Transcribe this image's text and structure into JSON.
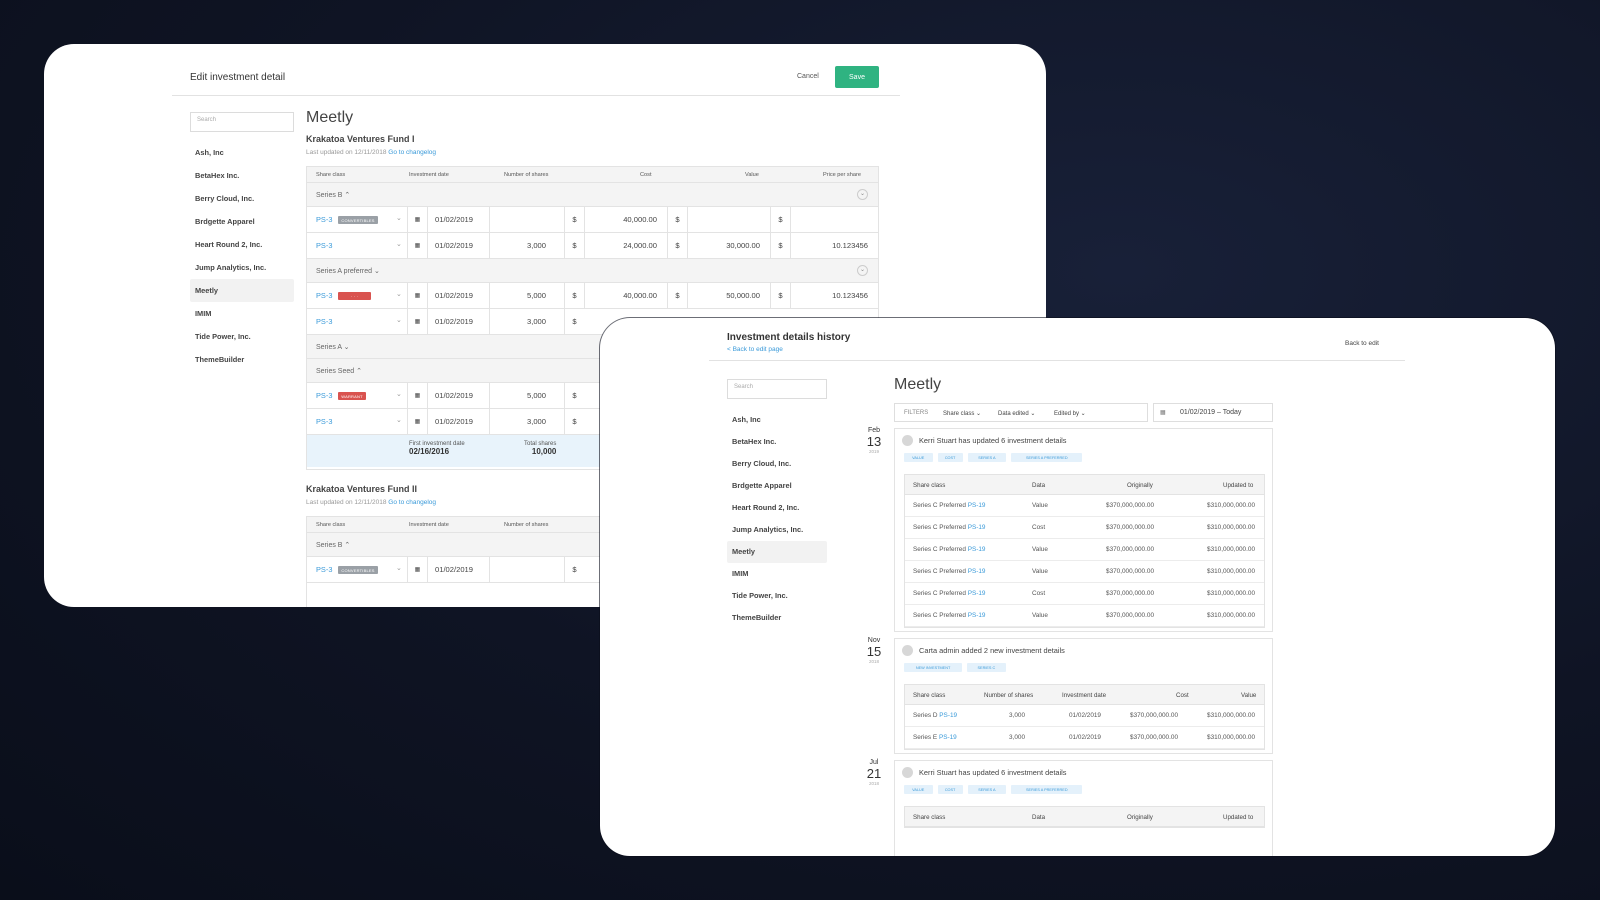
{
  "edit": {
    "title": "Edit investment detail",
    "cancel": "Cancel",
    "save": "Save",
    "search_placeholder": "Search",
    "companies": [
      "Ash, Inc",
      "BetaHex Inc.",
      "Berry Cloud, Inc.",
      "Brdgette Apparel",
      "Heart Round 2, Inc.",
      "Jump Analytics, Inc.",
      "Meetly",
      "IMIM",
      "Tide Power, Inc.",
      "ThemeBuilder"
    ],
    "active_company": "Meetly",
    "company_title": "Meetly",
    "fund1": {
      "name": "Krakatoa Ventures Fund I",
      "updated": "Last updated on 12/11/2018",
      "changelog": "Go to changelog",
      "headers": [
        "Share class",
        "Investment date",
        "Number of shares",
        "Cost",
        "Value",
        "Price per share"
      ],
      "groups": {
        "b": "Series B ⌃",
        "ap": "Series A preferred ⌄",
        "a": "Series A ⌄",
        "seed": "Series Seed ⌃"
      },
      "rows": [
        {
          "ps": "PS-3",
          "tag": "CONVERTIBLES",
          "date": "01/02/2019",
          "shares": "",
          "cost": "40,000.00",
          "value": "",
          "pps": ""
        },
        {
          "ps": "PS-3",
          "tag": "",
          "date": "01/02/2019",
          "shares": "3,000",
          "cost": "24,000.00",
          "value": "30,000.00",
          "pps": "10.123456"
        },
        {
          "ps": "PS-3",
          "tag": "· · ·",
          "date": "01/02/2019",
          "shares": "5,000",
          "cost": "40,000.00",
          "value": "50,000.00",
          "pps": "10.123456"
        },
        {
          "ps": "PS-3",
          "tag": "",
          "date": "01/02/2019",
          "shares": "3,000"
        },
        {
          "ps": "PS-3",
          "tag": "WARRANT",
          "date": "01/02/2019",
          "shares": "5,000"
        },
        {
          "ps": "PS-3",
          "tag": "",
          "date": "01/02/2019",
          "shares": "3,000"
        }
      ],
      "currency": "$",
      "summary": {
        "first_label": "First investment date",
        "first_value": "02/16/2016",
        "total_label": "Total shares",
        "total_value": "10,000"
      }
    },
    "fund2": {
      "name": "Krakatoa Ventures Fund II",
      "updated": "Last updated on 12/11/2018",
      "changelog": "Go to changelog",
      "headers": [
        "Share class",
        "Investment date",
        "Number of shares"
      ],
      "group": "Series B ⌃",
      "row": {
        "ps": "PS-3",
        "tag": "CONVERTIBLES",
        "date": "01/02/2019"
      }
    }
  },
  "history": {
    "title": "Investment details history",
    "back_link": "< Back to edit page",
    "back_btn": "Back to edit",
    "search_placeholder": "Search",
    "companies": [
      "Ash, Inc",
      "BetaHex Inc.",
      "Berry Cloud, Inc.",
      "Brdgette Apparel",
      "Heart Round 2, Inc.",
      "Jump Analytics, Inc.",
      "Meetly",
      "IMIM",
      "Tide Power, Inc.",
      "ThemeBuilder"
    ],
    "active_company": "Meetly",
    "company_title": "Meetly",
    "filters": {
      "label": "FILTERS",
      "share_class": "Share class ⌄",
      "data_edited": "Data edited ⌄",
      "edited_by": "Edited by ⌄",
      "date_range": "01/02/2019 – Today"
    },
    "events": [
      {
        "month": "Feb",
        "day": "13",
        "year": "2019",
        "title": "Kerri Stuart has updated 6 investment details",
        "chips": [
          "VALUE",
          "COST",
          "SERIES A",
          "SERIES A PREFERRED"
        ],
        "headers": [
          "Share class",
          "Data",
          "Originally",
          "Updated to"
        ],
        "rows": [
          [
            "Series C Preferred",
            "PS-19",
            "Value",
            "$370,000,000.00",
            "$310,000,000.00"
          ],
          [
            "Series C Preferred",
            "PS-19",
            "Cost",
            "$370,000,000.00",
            "$310,000,000.00"
          ],
          [
            "Series C Preferred",
            "PS-19",
            "Value",
            "$370,000,000.00",
            "$310,000,000.00"
          ],
          [
            "Series C Preferred",
            "PS-19",
            "Value",
            "$370,000,000.00",
            "$310,000,000.00"
          ],
          [
            "Series C Preferred",
            "PS-19",
            "Cost",
            "$370,000,000.00",
            "$310,000,000.00"
          ],
          [
            "Series C Preferred",
            "PS-19",
            "Value",
            "$370,000,000.00",
            "$310,000,000.00"
          ]
        ]
      },
      {
        "month": "Nov",
        "day": "15",
        "year": "2018",
        "title": "Carta admin added 2 new investment details",
        "chips": [
          "NEW INVESTMENT",
          "SERIES C"
        ],
        "headers": [
          "Share class",
          "Number of shares",
          "Investment date",
          "Cost",
          "Value"
        ],
        "rows": [
          [
            "Series D",
            "PS-19",
            "3,000",
            "01/02/2019",
            "$370,000,000.00",
            "$310,000,000.00"
          ],
          [
            "Series E",
            "PS-19",
            "3,000",
            "01/02/2019",
            "$370,000,000.00",
            "$310,000,000.00"
          ]
        ]
      },
      {
        "month": "Jul",
        "day": "21",
        "year": "2018",
        "title": "Kerri Stuart has updated 6 investment details",
        "chips": [
          "VALUE",
          "COST",
          "SERIES A",
          "SERIES A PREFERRED"
        ],
        "headers": [
          "Share class",
          "Data",
          "Originally",
          "Updated to"
        ]
      }
    ]
  }
}
